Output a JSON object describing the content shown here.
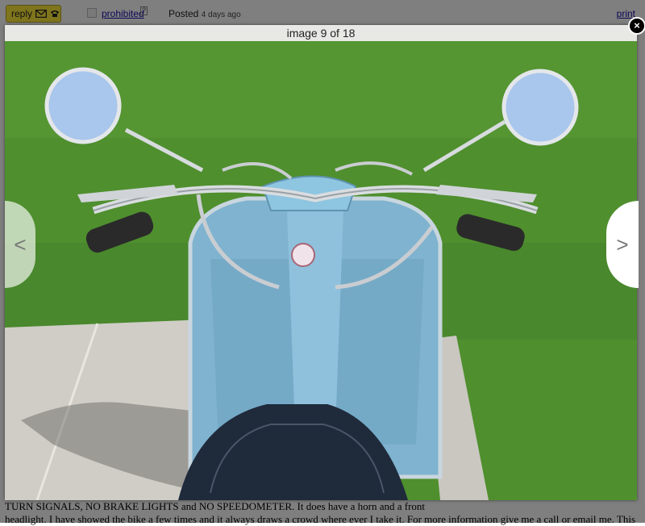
{
  "header": {
    "reply_label": "reply",
    "prohibited_label": "prohibited",
    "help_label": "?",
    "posted_label": "Posted",
    "posted_ago": "4 days ago",
    "print_label": "print"
  },
  "gallery": {
    "caption": "image 9 of 18",
    "prev_label": "<",
    "next_label": ">",
    "close_label": "×"
  },
  "description": {
    "line1": "TURN SIGNALS, NO BRAKE LIGHTS and NO SPEEDOMETER. It does have a horn and a front",
    "line2": "headlight. I have showed the bike a few times and it always draws a crowd where ever I take it. For more information give me a call or email me. This"
  },
  "colors": {
    "reply_bg": "#ffeb3b",
    "scooter_blue": "#7fb3cf",
    "grass": "#4f8f2e"
  },
  "icons": [
    "mail-icon",
    "phone-icon",
    "close-icon",
    "chevron-left-icon",
    "chevron-right-icon"
  ]
}
